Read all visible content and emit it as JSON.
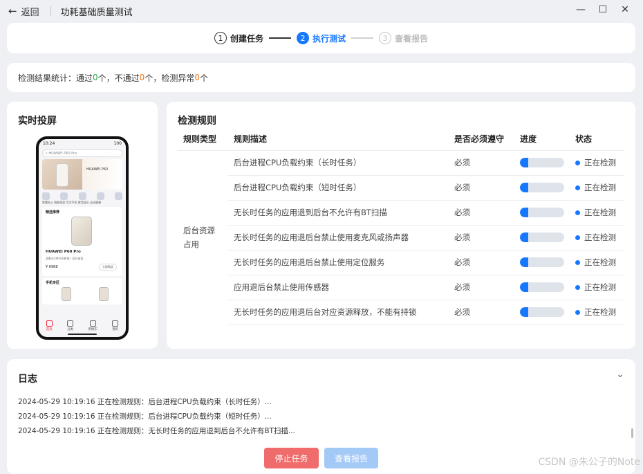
{
  "window": {
    "back_label": "返回",
    "title": "功耗基础质量测试",
    "controls": [
      "minimize",
      "maximize",
      "close"
    ]
  },
  "stepper": {
    "steps": [
      {
        "num": "1",
        "label": "创建任务",
        "state": "done"
      },
      {
        "num": "2",
        "label": "执行测试",
        "state": "active"
      },
      {
        "num": "3",
        "label": "查看报告",
        "state": "todo"
      }
    ]
  },
  "stats": {
    "prefix": "检测结果统计：通过",
    "pass_count": "0",
    "pass_unit": "个，不通过",
    "fail_count": "0",
    "fail_unit": "个，检测异常",
    "error_count": "0",
    "error_unit": "个"
  },
  "screen": {
    "title": "实时投屏",
    "phone": {
      "time": "10:24",
      "battery": "100",
      "search": "HUAWEI P60 Pro",
      "banner_text": "HUAWEI P60",
      "icon_labels": "智慧办公 智能家居 华为手机 影音娱乐 运动健康",
      "rec_title": "精选推荐",
      "product_name": "HUAWEI P60 Pro",
      "product_desc": "超聚光XMAGE影像 | 昆仑玻璃",
      "price": "¥ 6988",
      "buy": "立即购买",
      "zone_title": "手机专区",
      "tabs": [
        "首页",
        "分类",
        "购物车",
        "我的"
      ]
    }
  },
  "rules": {
    "title": "检测规则",
    "headers": [
      "规则类型",
      "规则描述",
      "是否必须遵守",
      "进度",
      "状态"
    ],
    "type": "后台资源占用",
    "rows": [
      {
        "desc": "后台进程CPU负载约束（长时任务）",
        "required": "必须",
        "progress": 0.18,
        "status": "正在检测"
      },
      {
        "desc": "后台进程CPU负载约束（短时任务）",
        "required": "必须",
        "progress": 0.18,
        "status": "正在检测"
      },
      {
        "desc": "无长时任务的应用退到后台不允许有BT扫描",
        "required": "必须",
        "progress": 0.18,
        "status": "正在检测"
      },
      {
        "desc": "无长时任务的应用退后台禁止使用麦克风或扬声器",
        "required": "必须",
        "progress": 0.18,
        "status": "正在检测"
      },
      {
        "desc": "无长时任务的应用退后台禁止使用定位服务",
        "required": "必须",
        "progress": 0.18,
        "status": "正在检测"
      },
      {
        "desc": "应用退后台禁止使用传感器",
        "required": "必须",
        "progress": 0.18,
        "status": "正在检测"
      },
      {
        "desc": "无长时任务的应用退后台对应资源释放，不能有持锁",
        "required": "必须",
        "progress": 0.18,
        "status": "正在检测"
      }
    ]
  },
  "log": {
    "title": "日志",
    "lines": [
      "2024-05-29 10:19:16 正在检测规则：后台进程CPU负载约束（长时任务）...",
      "2024-05-29 10:19:16 正在检测规则：后台进程CPU负载约束（短时任务）...",
      "2024-05-29 10:19:16 正在检测规则：无长时任务的应用退到后台不允许有BT扫描..."
    ]
  },
  "buttons": {
    "stop": "停止任务",
    "report": "查看报告"
  },
  "watermark": "CSDN @朱公子的Note",
  "colors": {
    "accent": "#1677ff",
    "pass": "#22a74a",
    "fail": "#f07b17",
    "stop_button": "#f06b6b",
    "report_button_disabled": "#a3c9f7"
  }
}
